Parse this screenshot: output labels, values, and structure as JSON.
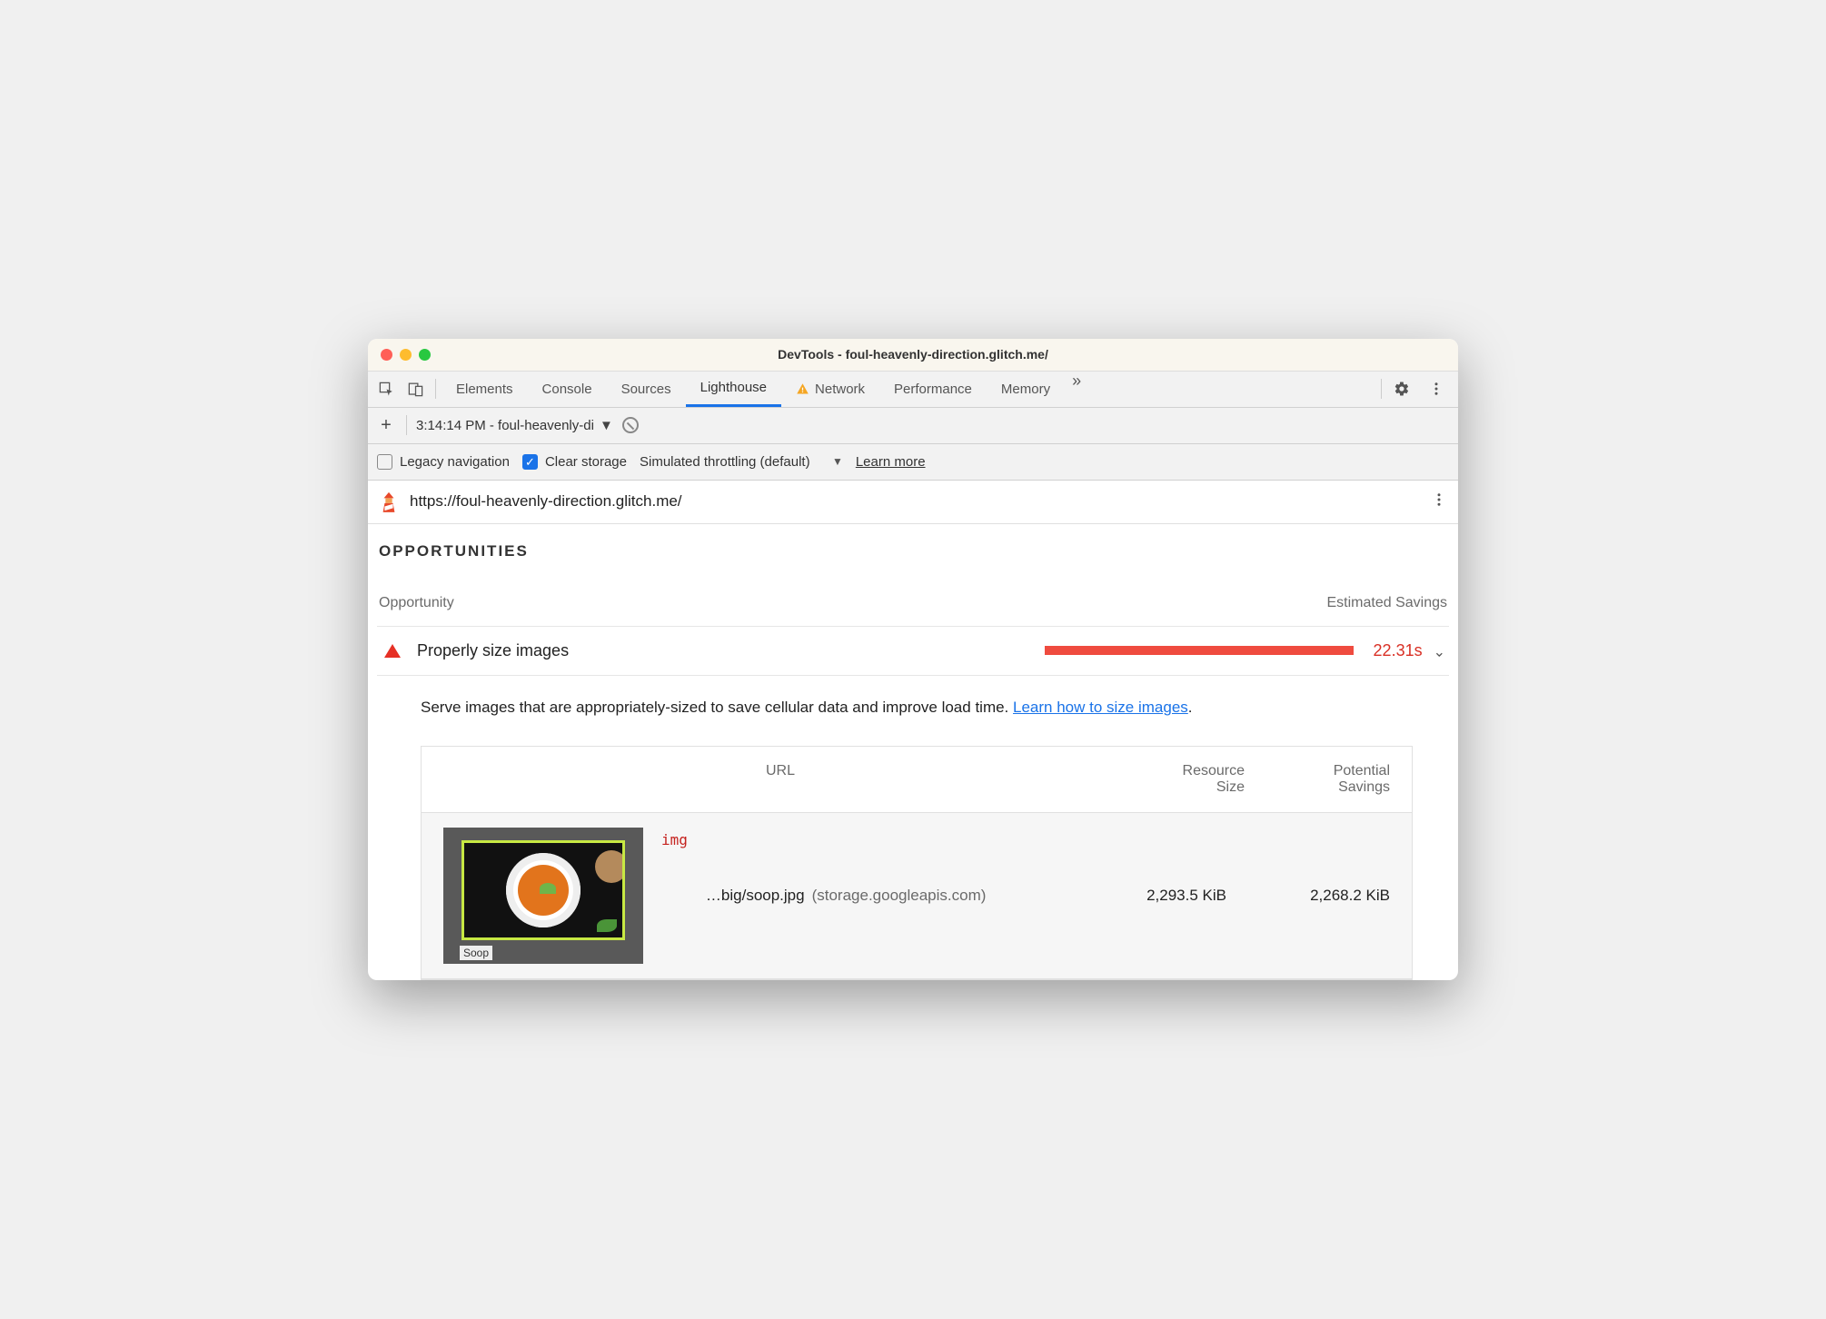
{
  "window": {
    "title": "DevTools - foul-heavenly-direction.glitch.me/"
  },
  "tabs": {
    "items": [
      "Elements",
      "Console",
      "Sources",
      "Lighthouse",
      "Network",
      "Performance",
      "Memory"
    ],
    "active": "Lighthouse",
    "network_has_warning": true
  },
  "subbar": {
    "run_label": "3:14:14 PM - foul-heavenly-di"
  },
  "options": {
    "legacy_label": "Legacy navigation",
    "legacy_checked": false,
    "clear_label": "Clear storage",
    "clear_checked": true,
    "throttle_label": "Simulated throttling (default)",
    "learn_more": "Learn more"
  },
  "urlbar": {
    "url": "https://foul-heavenly-direction.glitch.me/"
  },
  "section": {
    "title": "OPPORTUNITIES",
    "col_left": "Opportunity",
    "col_right": "Estimated Savings"
  },
  "opportunity": {
    "title": "Properly size images",
    "value": "22.31s",
    "description_pre": "Serve images that are appropriately-sized to save cellular data and improve load time. ",
    "description_link": "Learn how to size images",
    "description_post": "."
  },
  "table": {
    "head_url": "URL",
    "head_size_1": "Resource",
    "head_size_2": "Size",
    "head_save_1": "Potential",
    "head_save_2": "Savings",
    "rows": [
      {
        "tag": "img",
        "path": "…big/soop.jpg",
        "host": "(storage.googleapis.com)",
        "size": "2,293.5 KiB",
        "savings": "2,268.2 KiB",
        "thumb_caption": "Soop"
      }
    ]
  }
}
